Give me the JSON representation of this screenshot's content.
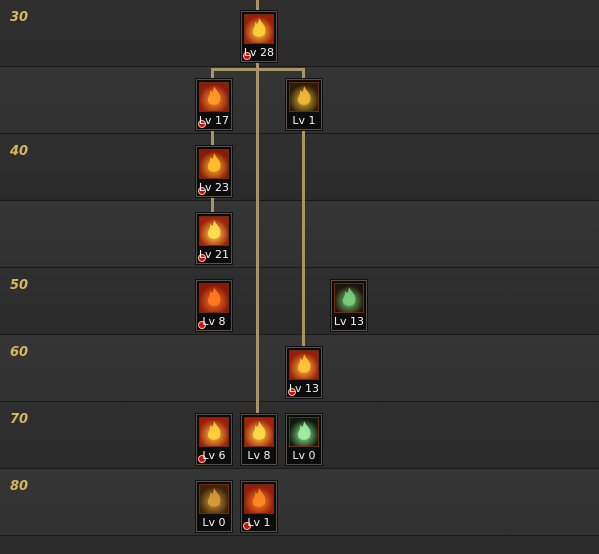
{
  "row_levels": [
    "30",
    "",
    "40",
    "",
    "50",
    "60",
    "70",
    "80"
  ],
  "skills": [
    {
      "id": "skill-1",
      "level_text": "Lv 28",
      "icon": "fire-burst-icon",
      "icon_bg": "#9c1c0a",
      "icon_fg": "#ffd23a"
    },
    {
      "id": "skill-2",
      "level_text": "Lv 17",
      "icon": "dark-flame-icon",
      "icon_bg": "#8e1a0c",
      "icon_fg": "#ff9c2a"
    },
    {
      "id": "skill-3",
      "level_text": "Lv 1",
      "icon": "golden-vortex-icon",
      "icon_bg": "#2a1e08",
      "icon_fg": "#f0b93a"
    },
    {
      "id": "skill-4",
      "level_text": "Lv 23",
      "icon": "rising-fire-figure-icon",
      "icon_bg": "#8a1a08",
      "icon_fg": "#ffbf2e"
    },
    {
      "id": "skill-5",
      "level_text": "Lv 21",
      "icon": "ground-explosion-icon",
      "icon_bg": "#a0200a",
      "icon_fg": "#ffe050"
    },
    {
      "id": "skill-6",
      "level_text": "Lv 8",
      "icon": "flaming-blade-icon",
      "icon_bg": "#8c180a",
      "icon_fg": "#ff7a20"
    },
    {
      "id": "skill-7",
      "level_text": "Lv 13",
      "icon": "green-summon-icon",
      "icon_bg": "#20140a",
      "icon_fg": "#7ad07a"
    },
    {
      "id": "skill-8",
      "level_text": "Lv 13",
      "icon": "fire-fist-burst-icon",
      "icon_bg": "#9a1c0a",
      "icon_fg": "#ffc43a"
    },
    {
      "id": "skill-9",
      "level_text": "Lv 6",
      "icon": "fire-impact-icon",
      "icon_bg": "#9e1e0a",
      "icon_fg": "#ffd040"
    },
    {
      "id": "skill-10",
      "level_text": "Lv 8",
      "icon": "fire-eruption-icon",
      "icon_bg": "#a4220c",
      "icon_fg": "#ffdc48"
    },
    {
      "id": "skill-11",
      "level_text": "Lv 0",
      "icon": "green-spirit-icon",
      "icon_bg": "#0c1c0c",
      "icon_fg": "#9ff0a0"
    },
    {
      "id": "skill-12",
      "level_text": "Lv 0",
      "icon": "fire-pillars-icon",
      "icon_bg": "#3a220a",
      "icon_fg": "#d69a3a"
    },
    {
      "id": "skill-13",
      "level_text": "Lv 1",
      "icon": "flame-dragon-icon",
      "icon_bg": "#941c0a",
      "icon_fg": "#ff8a24"
    }
  ],
  "colors": {
    "level_label": "#d8b65a",
    "connector": "#a89566",
    "locked_dot": "#c81010"
  }
}
